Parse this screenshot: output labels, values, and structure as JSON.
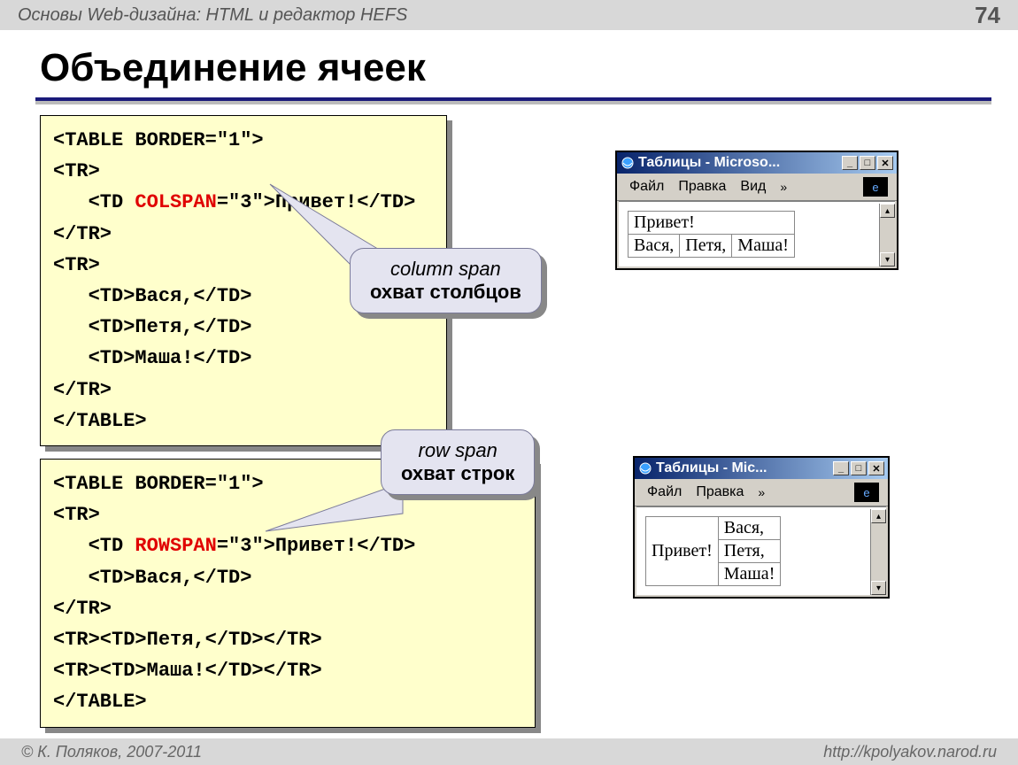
{
  "header": {
    "course_title": "Основы Web-дизайна: HTML и редактор HEFS",
    "page_number": "74"
  },
  "title": "Объединение ячеек",
  "code1": {
    "l1": "<TABLE BORDER=\"1\">",
    "l2": "<TR>",
    "l3a": "   <TD ",
    "l3b": "COLSPAN",
    "l3c": "=\"3\">Привет!</TD>",
    "l4": "</TR>",
    "l5": "<TR>",
    "l6": "   <TD>Вася,</TD>",
    "l7": "   <TD>Петя,</TD>",
    "l8": "   <TD>Маша!</TD>",
    "l9": "</TR>",
    "l10": "</TABLE>"
  },
  "code2": {
    "l1": "<TABLE BORDER=\"1\">",
    "l2": "<TR>",
    "l3a": "   <TD ",
    "l3b": "ROWSPAN",
    "l3c": "=\"3\">Привет!</TD>",
    "l4": "   <TD>Вася,</TD>",
    "l5": "</TR>",
    "l6": "<TR><TD>Петя,</TD></TR>",
    "l7": "<TR><TD>Маша!</TD></TR>",
    "l8": "</TABLE>"
  },
  "callout1": {
    "en": "column span",
    "ru": "охват столбцов"
  },
  "callout2": {
    "en": "row span",
    "ru": "охват строк"
  },
  "win1": {
    "title": "Таблицы - Microso...",
    "menu": {
      "file": "Файл",
      "edit": "Правка",
      "view": "Вид",
      "chev": "»"
    },
    "t": {
      "r1c1": "Привет!",
      "r2c1": "Вася,",
      "r2c2": "Петя,",
      "r2c3": "Маша!"
    }
  },
  "win2": {
    "title": "Таблицы - Mic...",
    "menu": {
      "file": "Файл",
      "edit": "Правка",
      "chev": "»"
    },
    "t": {
      "r1c1": "Привет!",
      "r1c2": "Вася,",
      "r2c2": "Петя,",
      "r3c2": "Маша!"
    }
  },
  "footer": {
    "left": "© К. Поляков, 2007-2011",
    "right": "http://kpolyakov.narod.ru"
  }
}
